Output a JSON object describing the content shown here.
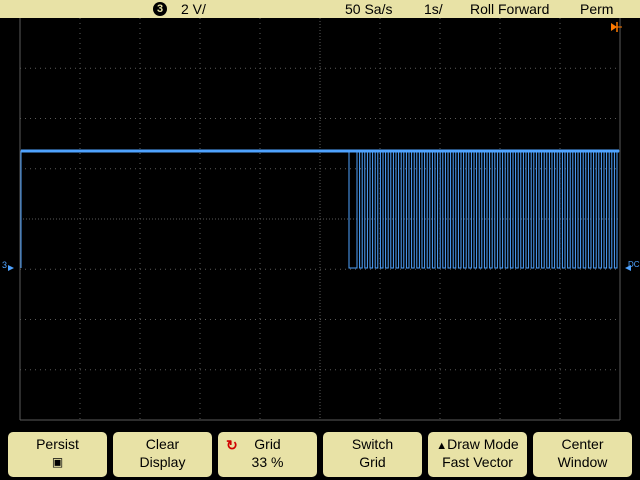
{
  "status_bar": {
    "channel": "3",
    "volts_per_div": "2 V/",
    "sample_rate": "50 Sa/s",
    "time_per_div": "1s/",
    "acquisition_mode": "Roll Forward",
    "persistence": "Perm"
  },
  "markers": {
    "channel_ground": "3",
    "trigger_coupling": "DC"
  },
  "softkeys": [
    {
      "line1": "Persist",
      "line2": "▣"
    },
    {
      "line1": "Clear",
      "line2": "Display"
    },
    {
      "line1": "Grid",
      "line2": "33 %"
    },
    {
      "line1": "Switch",
      "line2": "Grid"
    },
    {
      "line1": "Draw Mode",
      "line2": "Fast Vector"
    },
    {
      "line1": "Center",
      "line2": "Window"
    }
  ],
  "icons": {
    "channel_badge": "channel-3-badge",
    "grid_knob": "rotate-knob-icon",
    "draw_mode": "triangle-up-icon",
    "trigger": "trigger-arrow-icon"
  },
  "colors": {
    "status_bar_bg": "#e8e2a6",
    "trace": "#4fa3ff",
    "grid": "#5a5a5a",
    "trigger_marker": "#ff7a00"
  }
}
